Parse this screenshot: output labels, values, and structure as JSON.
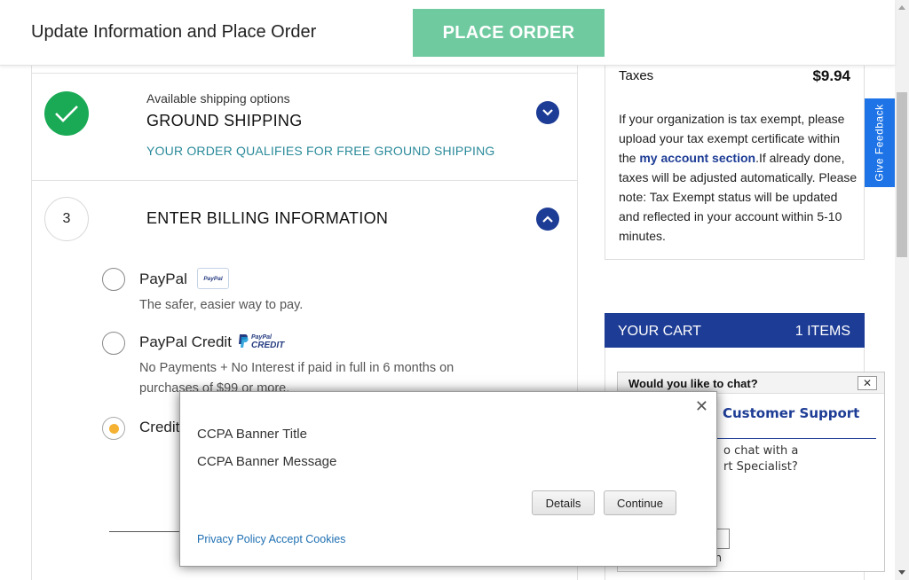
{
  "header": {
    "title": "Update Information and Place Order",
    "place_order_label": "PLACE ORDER"
  },
  "shipping": {
    "label": "Available shipping options",
    "method": "GROUND SHIPPING",
    "free_note": "YOUR ORDER QUALIFIES FOR FREE GROUND SHIPPING"
  },
  "billing": {
    "step_number": "3",
    "title": "ENTER BILLING INFORMATION",
    "options": [
      {
        "title": "PayPal",
        "desc": "The safer, easier way to pay.",
        "selected": false
      },
      {
        "title": "PayPal Credit",
        "desc": "No Payments + No Interest if paid in full in 6 months on purchases of $99 or more.",
        "selected": false
      },
      {
        "title": "Credit",
        "selected": true
      }
    ],
    "paypal_badge": "PayPal",
    "paypal_credit_logo": {
      "top": "PayPal",
      "bottom": "CREDIT"
    }
  },
  "summary": {
    "tax_label": "Taxes",
    "tax_value": "$9.94",
    "tax_note_1": "If your organization is tax exempt, please upload your tax exempt certificate within the ",
    "tax_note_link": "my account section",
    "tax_note_2": ".If already done, taxes will be adjusted automatically. Please note: Tax Exempt status will be updated and reflected in your account within 5-10 minutes."
  },
  "feedback": {
    "label": "Give Feedback"
  },
  "cart": {
    "title": "YOUR CART",
    "count": "1 ITEMS"
  },
  "chat": {
    "header": "Would you like to chat?",
    "close": "✕",
    "team": "Customer Support",
    "question_1": "o chat with a",
    "question_2": "rt Specialist?",
    "join": "in"
  },
  "modal": {
    "title": "CCPA Banner Title",
    "message": "CCPA Banner Message",
    "close": "✕",
    "details_label": "Details",
    "continue_label": "Continue",
    "link_text": "Privacy Policy Accept Cookies"
  },
  "colors": {
    "place_order_bg": "#6fcaa0",
    "navy": "#1d3c95",
    "success_green": "#1aaa55",
    "feedback_blue": "#1e74e6",
    "radio_selected": "#f4b132"
  }
}
